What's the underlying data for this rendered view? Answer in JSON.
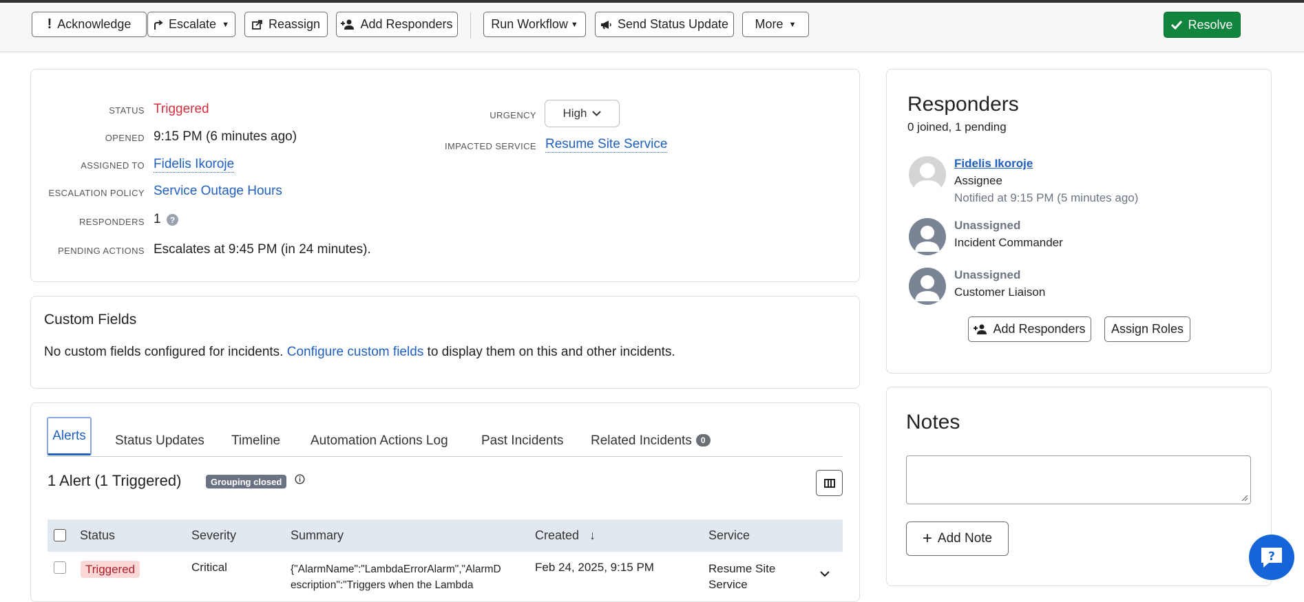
{
  "toolbar": {
    "acknowledge": "Acknowledge",
    "escalate": "Escalate",
    "reassign": "Reassign",
    "add_responders": "Add Responders",
    "run_workflow": "Run Workflow",
    "send_status_update": "Send Status Update",
    "more": "More",
    "resolve": "Resolve"
  },
  "details": {
    "status_label": "STATUS",
    "status_value": "Triggered",
    "opened_label": "OPENED",
    "opened_value": "9:15 PM (6 minutes ago)",
    "assigned_label": "ASSIGNED TO",
    "assigned_value": "Fidelis Ikoroje",
    "escalation_label": "ESCALATION POLICY",
    "escalation_value": "Service Outage Hours",
    "responders_label": "RESPONDERS",
    "responders_value": "1",
    "pending_label": "PENDING ACTIONS",
    "pending_value": "Escalates at 9:45 PM (in 24 minutes).",
    "urgency_label": "URGENCY",
    "urgency_value": "High",
    "impacted_label": "IMPACTED SERVICE",
    "impacted_value": "Resume Site Service"
  },
  "custom_fields": {
    "title": "Custom Fields",
    "text_before": "No custom fields configured for incidents. ",
    "link": "Configure custom fields",
    "text_after": " to display them on this and other incidents."
  },
  "tabs": [
    {
      "label": "Alerts"
    },
    {
      "label": "Status Updates"
    },
    {
      "label": "Timeline"
    },
    {
      "label": "Automation Actions Log"
    },
    {
      "label": "Past Incidents"
    },
    {
      "label": "Related Incidents",
      "badge": "0"
    }
  ],
  "alerts": {
    "heading": "1 Alert (1 Triggered)",
    "grouping_badge": "Grouping closed",
    "columns": [
      "Status",
      "Severity",
      "Summary",
      "Created",
      "Service"
    ],
    "rows": [
      {
        "status": "Triggered",
        "severity": "Critical",
        "summary_line1": "{\"AlarmName\":\"LambdaErrorAlarm\",\"AlarmD",
        "summary_line2": "escription\":\"Triggers when the Lambda",
        "created": "Feb 24, 2025, 9:15 PM",
        "service_line1": "Resume Site",
        "service_line2": "Service"
      }
    ]
  },
  "responders": {
    "title": "Responders",
    "summary": "0 joined, 1 pending",
    "list": [
      {
        "name": "Fidelis Ikoroje",
        "role": "Assignee",
        "note": "Notified at 9:15 PM (5 minutes ago)"
      },
      {
        "name": "Unassigned",
        "role": "Incident Commander"
      },
      {
        "name": "Unassigned",
        "role": "Customer Liaison"
      }
    ],
    "add_button": "Add Responders",
    "assign_button": "Assign Roles"
  },
  "notes": {
    "title": "Notes",
    "add_button": "Add Note"
  },
  "colors": {
    "link": "#1f5fbf",
    "status_red": "#d1303c",
    "resolve_green": "#11843d",
    "chat_blue": "#1565d8"
  }
}
